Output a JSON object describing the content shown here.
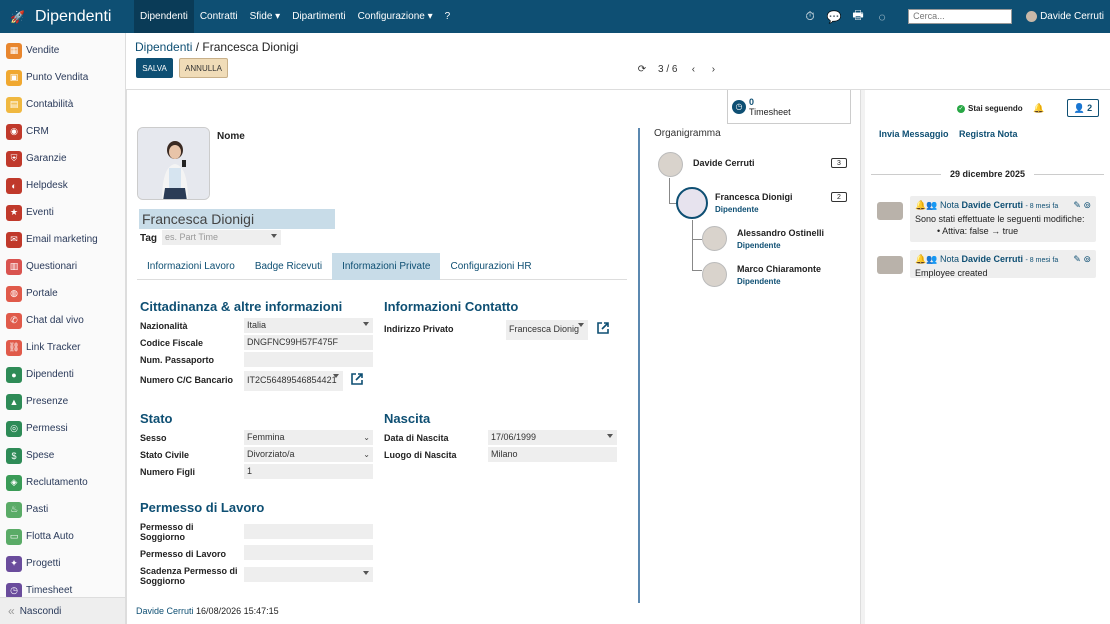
{
  "topbar": {
    "app_name": "Dipendenti",
    "menu": [
      "Dipendenti",
      "Contratti",
      "Sfide ▾",
      "Dipartimenti",
      "Configurazione ▾",
      "?"
    ],
    "search_placeholder": "Cerca...",
    "user_name": "Davide Cerruti"
  },
  "sidebar": {
    "items": [
      {
        "label": "Vendite",
        "color": "#e8862e"
      },
      {
        "label": "Punto Vendita",
        "color": "#f0a830"
      },
      {
        "label": "Contabilità",
        "color": "#f0b840"
      },
      {
        "label": "CRM",
        "color": "#c0392b"
      },
      {
        "label": "Garanzie",
        "color": "#c0392b"
      },
      {
        "label": "Helpdesk",
        "color": "#c0392b"
      },
      {
        "label": "Eventi",
        "color": "#c0392b"
      },
      {
        "label": "Email marketing",
        "color": "#c0392b"
      },
      {
        "label": "Questionari",
        "color": "#d9534f"
      },
      {
        "label": "Portale",
        "color": "#e05a4a"
      },
      {
        "label": "Chat dal vivo",
        "color": "#e05a4a"
      },
      {
        "label": "Link Tracker",
        "color": "#e05a4a"
      },
      {
        "label": "Dipendenti",
        "color": "#2e8b57"
      },
      {
        "label": "Presenze",
        "color": "#2e8b57"
      },
      {
        "label": "Permessi",
        "color": "#2e8b57"
      },
      {
        "label": "Spese",
        "color": "#2e8b57"
      },
      {
        "label": "Reclutamento",
        "color": "#3a9b57"
      },
      {
        "label": "Pasti",
        "color": "#5aab67"
      },
      {
        "label": "Flotta Auto",
        "color": "#5aab67"
      },
      {
        "label": "Progetti",
        "color": "#6a4c9c"
      },
      {
        "label": "Timesheet",
        "color": "#6a4c9c"
      }
    ],
    "hide_label": "Nascondi"
  },
  "control": {
    "breadcrumb_parent": "Dipendenti",
    "breadcrumb_sep": " / ",
    "breadcrumb_current": "Francesca Dionigi",
    "save_label": "SALVA",
    "cancel_label": "ANNULLA",
    "pager": "3 / 6"
  },
  "form": {
    "timesheet_count": "0",
    "timesheet_label": "Timesheet",
    "name_label": "Nome",
    "name_value": "Francesca Dionigi",
    "tag_label": "Tag",
    "tag_placeholder": "es. Part Time",
    "tabs": [
      "Informazioni Lavoro",
      "Badge Ricevuti",
      "Informazioni Private",
      "Configurazioni HR"
    ],
    "active_tab": 2,
    "citizenship": {
      "title": "Cittadinanza & altre informazioni",
      "nationality_label": "Nazionalità",
      "nationality": "Italia",
      "fiscal_label": "Codice Fiscale",
      "fiscal": "DNGFNC99H57F475F",
      "passport_label": "Num. Passaporto",
      "passport": "",
      "bank_label": "Numero C/C Bancario",
      "bank": "IT2C56489546854421"
    },
    "contact": {
      "title": "Informazioni Contatto",
      "address_label": "Indirizzo Privato",
      "address": "Francesca Dionig"
    },
    "status": {
      "title": "Stato",
      "sex_label": "Sesso",
      "sex": "Femmina",
      "civil_label": "Stato Civile",
      "civil": "Divorziato/a",
      "children_label": "Numero Figli",
      "children": "1"
    },
    "birth": {
      "title": "Nascita",
      "date_label": "Data di Nascita",
      "date": "17/06/1999",
      "place_label": "Luogo di Nascita",
      "place": "Milano"
    },
    "permit": {
      "title": "Permesso di Lavoro",
      "residence_label": "Permesso di Soggiorno",
      "residence": "",
      "work_label": "Permesso di Lavoro",
      "work": "",
      "expiry_label": "Scadenza Permesso di Soggiorno",
      "expiry": ""
    },
    "org": {
      "title": "Organigramma",
      "manager": {
        "name": "Davide Cerruti",
        "count": "3"
      },
      "self": {
        "name": "Francesca Dionigi",
        "role": "Dipendente",
        "count": "2"
      },
      "reports": [
        {
          "name": "Alessandro Ostinelli",
          "role": "Dipendente"
        },
        {
          "name": "Marco Chiaramonte",
          "role": "Dipendente"
        }
      ]
    },
    "footer_user": "Davide Cerruti",
    "footer_date": "16/08/2026 15:47:15"
  },
  "chatter": {
    "following": "Stai seguendo",
    "followers_count": "2",
    "send_message": "Invia Messaggio",
    "log_note": "Registra Nota",
    "date": "29 dicembre 2025",
    "messages": [
      {
        "type": "Nota",
        "author": "Davide Cerruti",
        "ago": "- 8 mesi fa",
        "line1": "Sono stati effettuate le seguenti modifiche:",
        "line2": "Attiva: false → true"
      },
      {
        "type": "Nota",
        "author": "Davide Cerruti",
        "ago": "- 8 mesi fa",
        "line1": "Employee created",
        "line2": ""
      }
    ]
  }
}
